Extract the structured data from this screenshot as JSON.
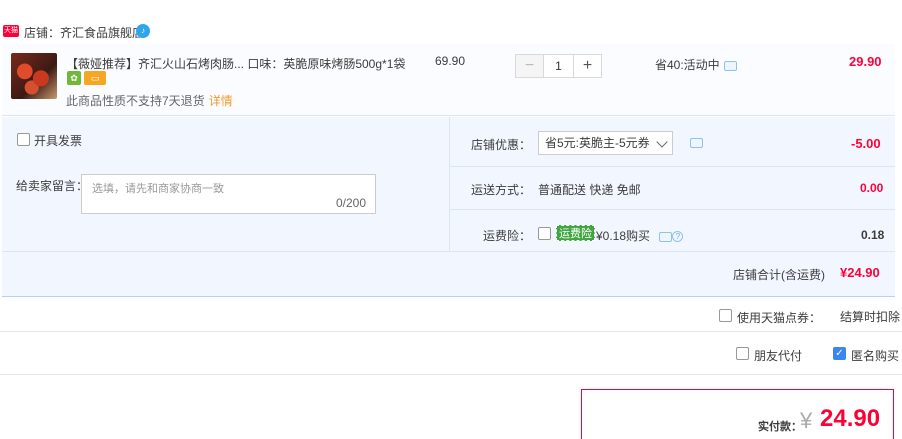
{
  "store": {
    "badge": "天猫",
    "label": "店铺：齐汇食品旗舰店",
    "chat_icon": "ww-icon",
    "chat_glyph": "♪"
  },
  "item": {
    "title": "【薇娅推荐】齐汇火山石烤肉肠...  口味：英脆原味烤肠500g*1袋",
    "tag1": "✿",
    "tag2": "▭",
    "refund_note": "此商品性质不支持7天退货",
    "refund_detail": "详情",
    "unit_price": "69.90",
    "qty": "1",
    "minus": "−",
    "plus": "+",
    "promo": "省40:活动中",
    "subtotal": "29.90"
  },
  "invoice": {
    "label": "开具发票"
  },
  "memo": {
    "label": "给卖家留言：",
    "placeholder": "选填，请先和商家协商一致",
    "count": "0/200"
  },
  "store_coupon": {
    "label": "店铺优惠：",
    "selected": "省5元:英脆主-5元券",
    "discount": "-5.00"
  },
  "shipping": {
    "label": "运送方式：",
    "method": "普通配送 快递 免邮",
    "fee": "0.00"
  },
  "insurance": {
    "label": "运费险：",
    "badge": "运费险",
    "price": "¥0.18购买",
    "help": "?",
    "fee": "0.18"
  },
  "store_total": {
    "label": "店铺合计(含运费)",
    "value": "¥24.90"
  },
  "tmall_points": {
    "label": "使用天猫点券：",
    "deduct": "结算时扣除"
  },
  "friend_pay": {
    "label": "朋友代付"
  },
  "anonymous": {
    "label": "匿名购买",
    "check": "✓"
  },
  "payment": {
    "label": "实付款：",
    "yen": "¥",
    "amount": "24.90"
  }
}
